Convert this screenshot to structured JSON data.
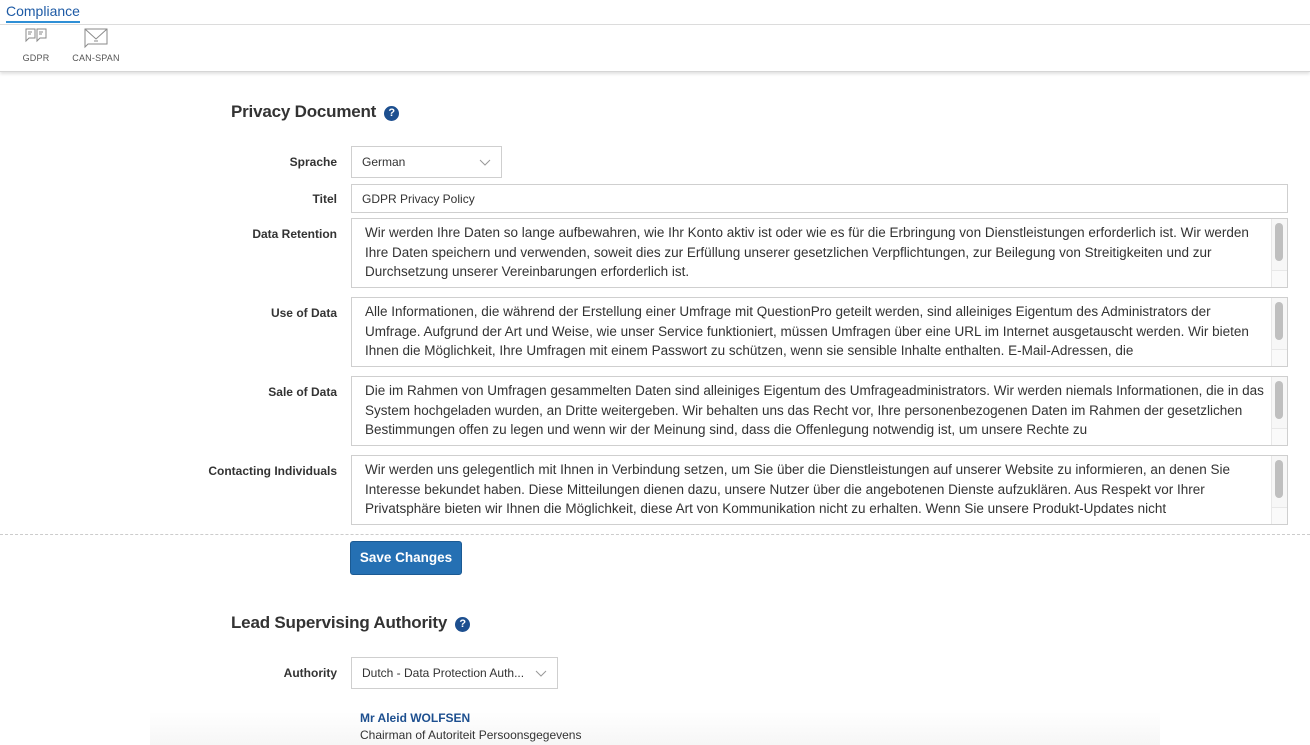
{
  "breadcrumb": {
    "label": "Compliance"
  },
  "toolbar": {
    "items": [
      {
        "label": "GDPR",
        "icon": "chat-bubbles-icon"
      },
      {
        "label": "CAN-SPAN",
        "icon": "envelope-icon"
      }
    ]
  },
  "privacy": {
    "title": "Privacy Document",
    "help": "?",
    "fields": {
      "language": {
        "label": "Sprache",
        "value": "German"
      },
      "title": {
        "label": "Titel",
        "value": "GDPR Privacy Policy"
      },
      "data_retention": {
        "label": "Data Retention",
        "value": "Wir werden Ihre Daten so lange aufbewahren, wie Ihr Konto aktiv ist oder wie es für die Erbringung von Dienstleistungen erforderlich ist. Wir werden Ihre Daten speichern und verwenden, soweit dies zur Erfüllung unserer gesetzlichen Verpflichtungen, zur Beilegung von Streitigkeiten und zur Durchsetzung unserer Vereinbarungen erforderlich ist."
      },
      "use_of_data": {
        "label": "Use of Data",
        "value": "Alle Informationen, die während der Erstellung einer Umfrage mit QuestionPro geteilt werden, sind alleiniges Eigentum des Administrators der Umfrage. Aufgrund der Art und Weise, wie unser Service funktioniert, müssen Umfragen über eine URL im Internet ausgetauscht werden. Wir bieten Ihnen die Möglichkeit, Ihre Umfragen mit einem Passwort zu schützen, wenn sie sensible Inhalte enthalten. E-Mail-Adressen, die"
      },
      "sale_of_data": {
        "label": "Sale of Data",
        "value": "Die im Rahmen von Umfragen gesammelten Daten sind alleiniges Eigentum des Umfrageadministrators. Wir werden niemals Informationen, die in das System hochgeladen wurden, an Dritte weitergeben. Wir behalten uns das Recht vor, Ihre personenbezogenen Daten im Rahmen der gesetzlichen Bestimmungen offen zu legen und wenn wir der Meinung sind, dass die Offenlegung notwendig ist, um unsere Rechte zu"
      },
      "contacting_individuals": {
        "label": "Contacting Individuals",
        "value": "Wir werden uns gelegentlich mit Ihnen in Verbindung setzen, um Sie über die Dienstleistungen auf unserer Website zu informieren, an denen Sie Interesse bekundet haben. Diese Mitteilungen dienen dazu, unsere Nutzer über die angebotenen Dienste aufzuklären. Aus Respekt vor Ihrer Privatsphäre bieten wir Ihnen die Möglichkeit, diese Art von Kommunikation nicht zu erhalten. Wenn Sie unsere Produkt-Updates nicht"
      }
    },
    "save_label": "Save Changes"
  },
  "authority": {
    "title": "Lead Supervising Authority",
    "help": "?",
    "label": "Authority",
    "value": "Dutch - Data Protection Auth...",
    "contact_name": "Mr Aleid WOLFSEN",
    "contact_role": "Chairman of Autoriteit Persoonsgegevens"
  },
  "colors": {
    "accent": "#2570b3",
    "link": "#1d5aa5",
    "help_icon": "#1d4f8f"
  }
}
